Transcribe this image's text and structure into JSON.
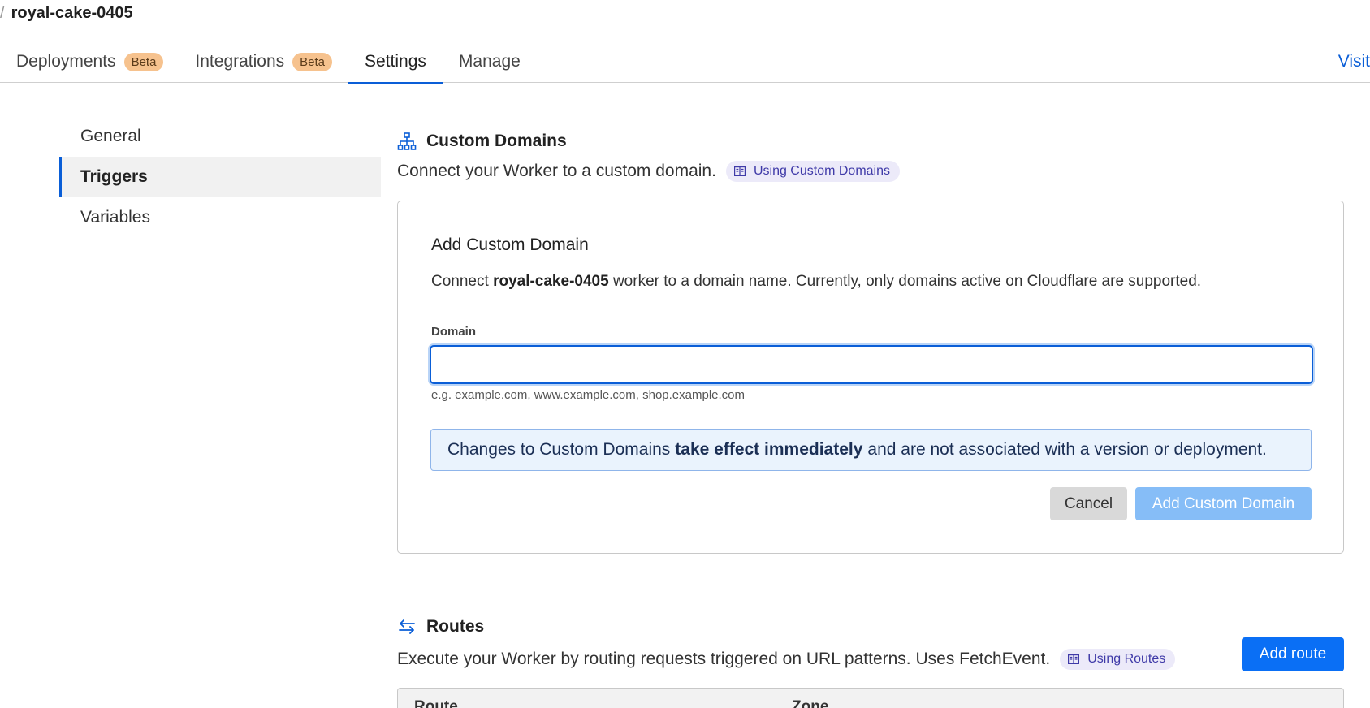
{
  "breadcrumb": {
    "separator": "/",
    "worker_name": "royal-cake-0405"
  },
  "tabs": [
    {
      "label": "Deployments",
      "badge": "Beta"
    },
    {
      "label": "Integrations",
      "badge": "Beta"
    },
    {
      "label": "Settings",
      "badge": null,
      "active": true
    },
    {
      "label": "Manage",
      "badge": null
    }
  ],
  "visit_link": "Visit",
  "sidebar": {
    "items": [
      {
        "label": "General"
      },
      {
        "label": "Triggers",
        "active": true
      },
      {
        "label": "Variables"
      }
    ]
  },
  "custom_domains": {
    "icon": "sitemap-icon",
    "title": "Custom Domains",
    "description": "Connect your Worker to a custom domain.",
    "doc_link": "Using Custom Domains",
    "card": {
      "heading": "Add Custom Domain",
      "lead_prefix": "Connect",
      "lead_worker": "royal-cake-0405",
      "lead_suffix": "worker to a domain name. Currently, only domains active on Cloudflare are supported.",
      "field_label": "Domain",
      "field_value": "",
      "field_hint": "e.g. example.com, www.example.com, shop.example.com",
      "notice_prefix": "Changes to Custom Domains",
      "notice_bold": "take effect immediately",
      "notice_suffix": "and are not associated with a version or deployment.",
      "cancel_label": "Cancel",
      "submit_label": "Add Custom Domain"
    }
  },
  "routes": {
    "icon": "arrows-exchange-icon",
    "title": "Routes",
    "description": "Execute your Worker by routing requests triggered on URL patterns. Uses FetchEvent.",
    "doc_link": "Using Routes",
    "add_label": "Add route",
    "columns": [
      "Route",
      "Zone"
    ]
  },
  "colors": {
    "accent": "#0a5ed7",
    "beta_badge": "#f6c28e",
    "notice_bg": "#eaf3fd",
    "disabled_button": "#86bdf7"
  }
}
